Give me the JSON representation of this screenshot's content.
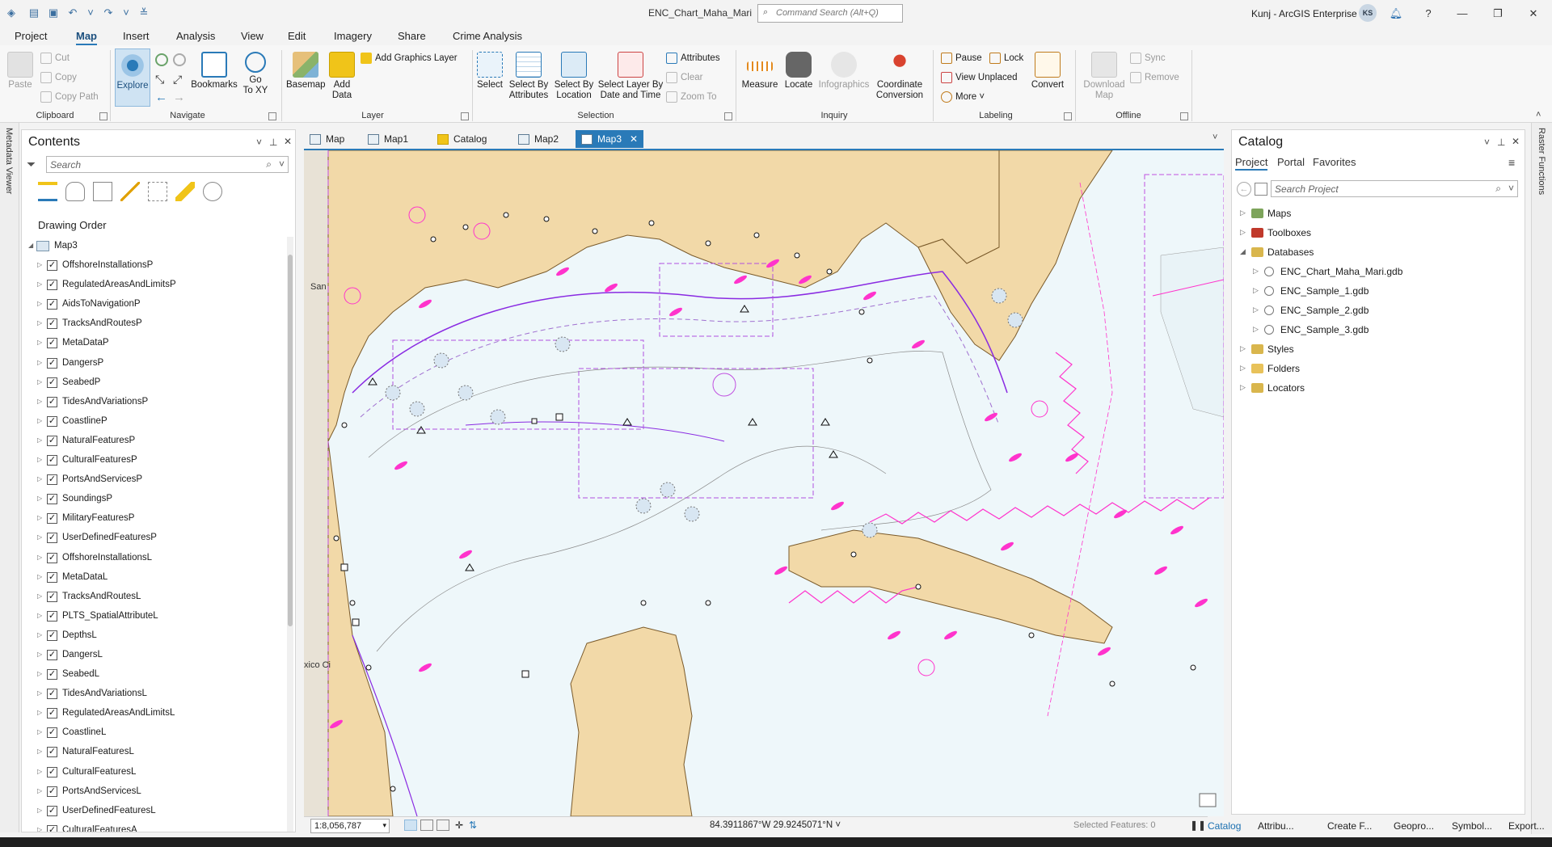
{
  "titlebar": {
    "doc_title": "ENC_Chart_Maha_Mari",
    "search_placeholder": "Command Search (Alt+Q)",
    "user": "Kunj - ArcGIS Enterprise",
    "avatar": "KS"
  },
  "menu_tabs": [
    "Project",
    "Map",
    "Insert",
    "Analysis",
    "View",
    "Edit",
    "Imagery",
    "Share",
    "Crime Analysis"
  ],
  "ribbon": {
    "clipboard": {
      "paste": "Paste",
      "cut": "Cut",
      "copy": "Copy",
      "copy_path": "Copy Path",
      "label": "Clipboard"
    },
    "navigate": {
      "explore": "Explore",
      "bookmarks": "Bookmarks",
      "goto_1": "Go",
      "goto_2": "To XY",
      "label": "Navigate"
    },
    "layer": {
      "basemap": "Basemap",
      "add_data_1": "Add",
      "add_data_2": "Data",
      "add_graphics": "Add Graphics Layer",
      "label": "Layer"
    },
    "selection": {
      "select": "Select",
      "by_attr_1": "Select By",
      "by_attr_2": "Attributes",
      "by_loc_1": "Select By",
      "by_loc_2": "Location",
      "by_layer_1": "Select Layer By",
      "by_layer_2": "Date and Time",
      "attributes": "Attributes",
      "clear": "Clear",
      "zoom_to": "Zoom To",
      "label": "Selection"
    },
    "inquiry": {
      "measure": "Measure",
      "locate": "Locate",
      "infographics": "Infographics",
      "coord_1": "Coordinate",
      "coord_2": "Conversion",
      "label": "Inquiry"
    },
    "labeling": {
      "pause": "Pause",
      "lock": "Lock",
      "view_unplaced": "View Unplaced",
      "more": "More",
      "convert": "Convert",
      "label": "Labeling"
    },
    "offline": {
      "download_1": "Download",
      "download_2": "Map",
      "sync": "Sync",
      "remove": "Remove",
      "label": "Offline"
    }
  },
  "left_strip": {
    "label": "Metadata Viewer"
  },
  "right_strip": {
    "label": "Raster Functions"
  },
  "contents": {
    "title": "Contents",
    "search_placeholder": "Search",
    "drawing_order": "Drawing Order",
    "map_name": "Map3",
    "layers": [
      "OffshoreInstallationsP",
      "RegulatedAreasAndLimitsP",
      "AidsToNavigationP",
      "TracksAndRoutesP",
      "MetaDataP",
      "DangersP",
      "SeabedP",
      "TidesAndVariationsP",
      "CoastlineP",
      "NaturalFeaturesP",
      "CulturalFeaturesP",
      "PortsAndServicesP",
      "SoundingsP",
      "MilitaryFeaturesP",
      "UserDefinedFeaturesP",
      "OffshoreInstallationsL",
      "MetaDataL",
      "TracksAndRoutesL",
      "PLTS_SpatialAttributeL",
      "DepthsL",
      "DangersL",
      "SeabedL",
      "TidesAndVariationsL",
      "RegulatedAreasAndLimitsL",
      "CoastlineL",
      "NaturalFeaturesL",
      "CulturalFeaturesL",
      "PortsAndServicesL",
      "UserDefinedFeaturesL",
      "CulturalFeaturesA"
    ]
  },
  "map_tabs": [
    "Map",
    "Map1",
    "Catalog",
    "Map2",
    "Map3"
  ],
  "map": {
    "scale": "1:8,056,787",
    "coordinates": "84.3911867°W 29.9245071°N",
    "selected_features": "Selected Features: 0",
    "place_labels": [
      "San",
      "xico Ci"
    ]
  },
  "catalog": {
    "title": "Catalog",
    "tabs": [
      "Project",
      "Portal",
      "Favorites"
    ],
    "search_placeholder": "Search Project",
    "items": {
      "maps": "Maps",
      "toolboxes": "Toolboxes",
      "databases": "Databases",
      "db1": "ENC_Chart_Maha_Mari.gdb",
      "db2": "ENC_Sample_1.gdb",
      "db3": "ENC_Sample_2.gdb",
      "db4": "ENC_Sample_3.gdb",
      "styles": "Styles",
      "folders": "Folders",
      "locators": "Locators"
    }
  },
  "bottom_tabs": [
    "Catalog",
    "Attribu...",
    "Create F...",
    "Geopro...",
    "Symbol...",
    "Export..."
  ],
  "colors": {
    "accent": "#2a7ab8",
    "land": "#f2d9a8",
    "water": "#eef7fa",
    "feature_magenta": "#ff33cc",
    "feature_purple": "#a020f0"
  }
}
